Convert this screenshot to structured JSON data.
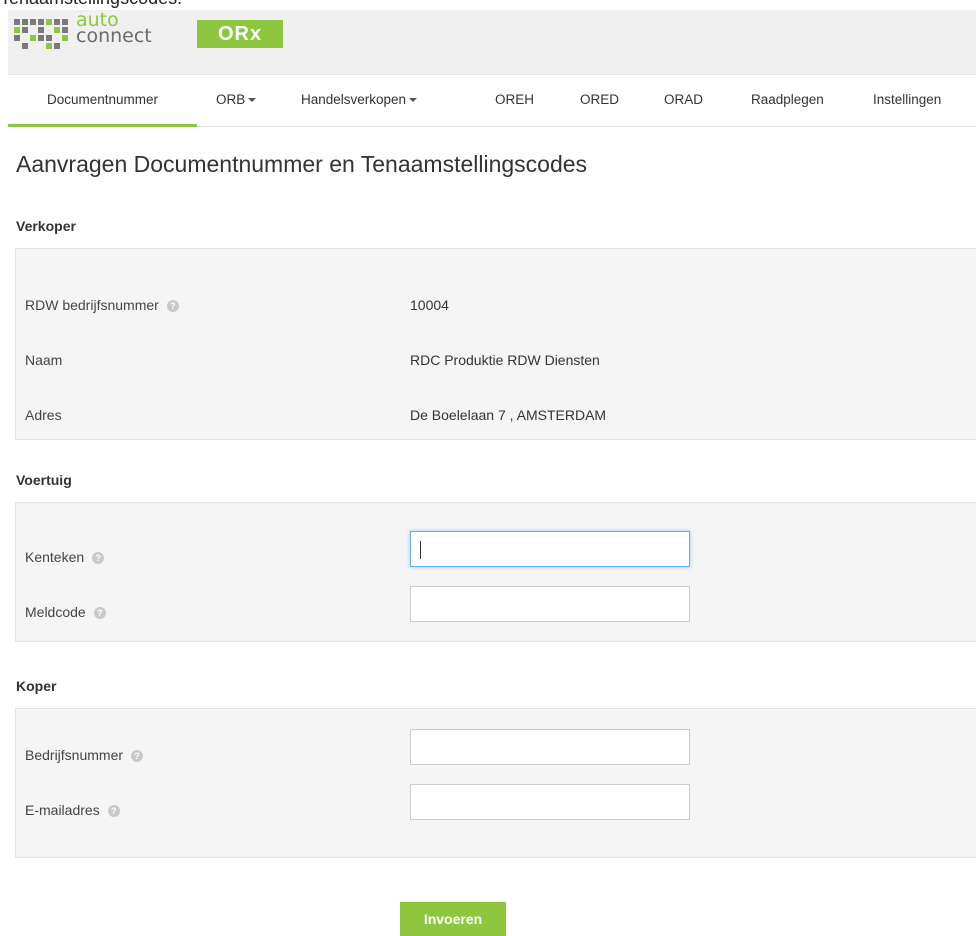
{
  "top_fragment": "Tenaamstellingscodes.",
  "brand": {
    "word_top": "auto",
    "word_bottom": "connect",
    "badge": "ORx",
    "accent": "#8dc63f"
  },
  "nav": {
    "items": [
      {
        "label": "Documentnummer",
        "active": true,
        "dropdown": false
      },
      {
        "label": "ORB",
        "active": false,
        "dropdown": true
      },
      {
        "label": "Handelsverkopen",
        "active": false,
        "dropdown": true
      },
      {
        "label": "OREH",
        "active": false,
        "dropdown": false
      },
      {
        "label": "ORED",
        "active": false,
        "dropdown": false
      },
      {
        "label": "ORAD",
        "active": false,
        "dropdown": false
      },
      {
        "label": "Raadplegen",
        "active": false,
        "dropdown": false
      },
      {
        "label": "Instellingen",
        "active": false,
        "dropdown": false
      }
    ]
  },
  "page": {
    "title": "Aanvragen Documentnummer en Tenaamstellingscodes"
  },
  "verkoper": {
    "title": "Verkoper",
    "rows": [
      {
        "label": "RDW bedrijfsnummer",
        "value": "10004"
      },
      {
        "label": "Naam",
        "value": "RDC Produktie RDW Diensten"
      },
      {
        "label": "Adres",
        "value": "De Boelelaan 7 , AMSTERDAM"
      }
    ]
  },
  "voertuig": {
    "title": "Voertuig",
    "kenteken": {
      "label": "Kenteken",
      "value": ""
    },
    "meldcode": {
      "label": "Meldcode",
      "value": ""
    }
  },
  "koper": {
    "title": "Koper",
    "bedrijfsnummer": {
      "label": "Bedrijfsnummer",
      "value": ""
    },
    "email": {
      "label": "E-mailadres",
      "value": ""
    }
  },
  "actions": {
    "submit_label": "Invoeren"
  },
  "icons": {
    "help": "help-icon",
    "dropdown": "caret-down-icon"
  }
}
